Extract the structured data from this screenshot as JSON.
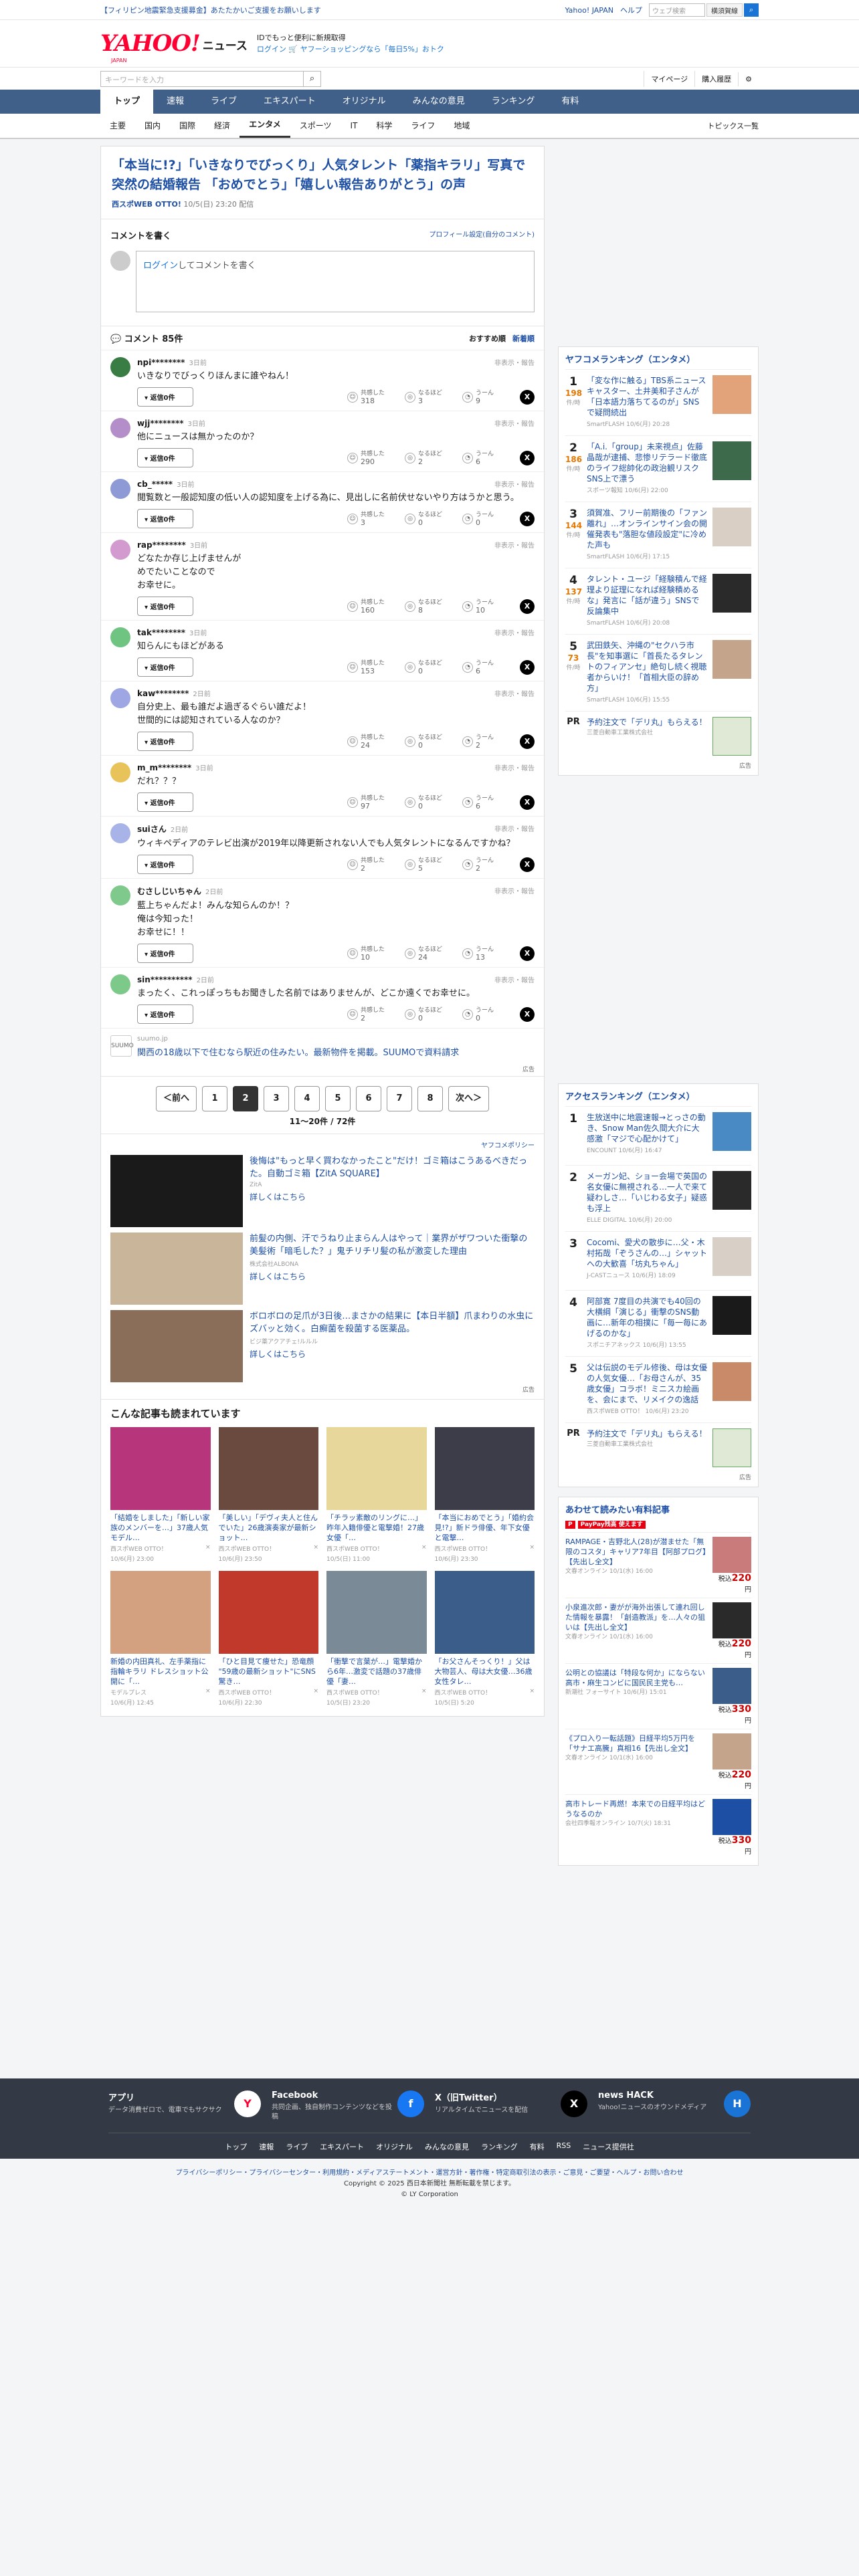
{
  "topbar": {
    "notice": "【フィリピン地震緊急支援募金】あたたかいご支援をお願いします",
    "links": [
      "Yahoo! JAPAN",
      "ヘルプ"
    ],
    "search_placeholder": "ウェブ検索",
    "search_btn": "横須賀線"
  },
  "header": {
    "logo": "YAHOO!",
    "news": "ニュース",
    "logo_sub": "JAPAN",
    "info1": "IDでもっと便利に新規取得",
    "info2": "ログイン 🛒 ヤフーショッピングなら「毎日5%」おトク"
  },
  "searchrow": {
    "placeholder": "キーワードを入力",
    "mypage": "マイページ",
    "purchase": "購入履歴"
  },
  "gnav": [
    "トップ",
    "速報",
    "ライブ",
    "エキスパート",
    "オリジナル",
    "みんなの意見",
    "ランキング",
    "有料"
  ],
  "snav": {
    "items": [
      "主要",
      "国内",
      "国際",
      "経済",
      "エンタメ",
      "スポーツ",
      "IT",
      "科学",
      "ライフ",
      "地域"
    ],
    "topics": "トピックス一覧"
  },
  "article": {
    "title": "「本当に!?」「いきなりでびっくり」人気タレント「薬指キラリ」写真で突然の結婚報告 「おめでとう」「嬉しい報告ありがとう」の声",
    "source": "西スポWEB OTTO!",
    "date": "10/5(日) 23:20 配信"
  },
  "comment_write": {
    "title": "コメントを書く",
    "profile": "プロフィール設定(自分のコメント)",
    "login": "ログイン",
    "placeholder": "してコメントを書く"
  },
  "comment_list": {
    "title": "コメント 85件",
    "sort1": "おすすめ順",
    "sort2": "新着順"
  },
  "reply_label": "返信0件",
  "report_label": "非表示・報告",
  "react_labels": [
    "共感した",
    "なるほど",
    "うーん"
  ],
  "comments": [
    {
      "name": "npi********",
      "time": "3日前",
      "text": "いきなりでびっくりほんまに誰やねん！",
      "r": [
        "318",
        "3",
        "9"
      ],
      "color": "#3a7d44"
    },
    {
      "name": "wjj********",
      "time": "3日前",
      "text": "他にニュースは無かったのか？",
      "r": [
        "290",
        "2",
        "6"
      ],
      "color": "#b48ec9"
    },
    {
      "name": "cb_*****",
      "time": "3日前",
      "text": "閲覧数と一般認知度の低い人の認知度を上げる為に、見出しに名前伏せないやり方はうかと思う。",
      "r": [
        "3",
        "0",
        "0"
      ],
      "color": "#8e9ad6"
    },
    {
      "name": "rap********",
      "time": "3日前",
      "text": "どなたか存じ上げませんが\nめでたいことなので\nお幸せに。",
      "r": [
        "160",
        "8",
        "10"
      ],
      "color": "#d39ad0"
    },
    {
      "name": "tak********",
      "time": "3日前",
      "text": "知らんにもほどがある",
      "r": [
        "153",
        "0",
        "6"
      ],
      "color": "#6fc481"
    },
    {
      "name": "kaw********",
      "time": "2日前",
      "text": "自分史上、最も誰だよ過ぎるぐらい誰だよ！\n世間的には認知されている人なのか？",
      "r": [
        "24",
        "0",
        "2"
      ],
      "color": "#9fa6e4"
    },
    {
      "name": "m_m********",
      "time": "3日前",
      "text": "だれ？？？",
      "r": [
        "97",
        "0",
        "6"
      ],
      "color": "#e8c35a"
    },
    {
      "name": "suiさん",
      "time": "2日前",
      "text": "ウィキペディアのテレビ出演が2019年以降更新されない人でも人気タレントになるんですかね？",
      "r": [
        "2",
        "5",
        "2"
      ],
      "color": "#a8b3e8"
    },
    {
      "name": "むさしじいちゃん",
      "time": "2日前",
      "text": "藍上ちゃんだよ！みんな知らんのか！？\n俺は今知った！\nお幸せに！！",
      "r": [
        "10",
        "24",
        "13"
      ],
      "color": "#7ec98b"
    },
    {
      "name": "sin**********",
      "time": "2日前",
      "text": "まったく、これっぽっちもお聞きした名前ではありませんが、どこか遠くでお幸せに。",
      "r": [
        "2",
        "0",
        "0"
      ],
      "color": "#7dc98a"
    }
  ],
  "ad1": {
    "logo": "SUUMO",
    "src": "suumo.jp",
    "title": "関西の18歳以下で住むなら駅近の住みたい。最新物件を掲載。SUUMOで資料請求",
    "label": "広告"
  },
  "pager": {
    "prev": "＜前へ",
    "pages": [
      "1",
      "2",
      "3",
      "4",
      "5",
      "6",
      "7",
      "8"
    ],
    "current": "2",
    "next": "次へ＞",
    "info": "11〜20件 / 72件"
  },
  "ads2": {
    "policy": "ヤフコメポリシー",
    "items": [
      {
        "title": "後悔は\"もっと早く買わなかったこと\"だけ！ゴミ箱はこうあるべきだった。自動ゴミ箱【ZitA SQUARE】",
        "src": "ZitA",
        "more": "詳しくはこちら",
        "bg": "#1a1a1a"
      },
      {
        "title": "前髪の内側、汗でうねり止まらん人はやって｜業界がザワついた衝撃の美髪術「暗毛した？」鬼チリチリ髪の私が激変した理由",
        "src": "株式会社ALBONA",
        "more": "詳しくはこちら",
        "bg": "#c9b59a"
      },
      {
        "title": "ボロボロの足爪が3日後…まさかの結果に【本日半額】爪まわりの水虫にズバッと効く。白癬菌を殺菌する医薬品。",
        "src": "ビジ薬アクアチェ!ルルル",
        "more": "詳しくはこちら",
        "bg": "#8b6e5a"
      }
    ],
    "label": "広告"
  },
  "related": {
    "title": "こんな記事も読まれています",
    "items": [
      {
        "t": "「結婚をしました」「新しい家族のメンバーを…」37歳人気モデル…",
        "s": "西スポWEB OTTO！",
        "d": "10/6(月) 23:00",
        "bg": "#b7357a"
      },
      {
        "t": "「美しい」「デヴィ夫人と住んでいた」26歳演奏家が最新ショット…",
        "s": "西スポWEB OTTO！",
        "d": "10/6(月) 23:50",
        "bg": "#6a4a3e"
      },
      {
        "t": "「チラッ素敵のリングに…」昨年入籍俳優と電撃婚！27歳女優「…",
        "s": "西スポWEB OTTO！",
        "d": "10/5(日) 11:00",
        "bg": "#e8d79a"
      },
      {
        "t": "「本当におめでとう」「婚約会見!?」新ドラ俳優、年下女優と電撃…",
        "s": "西スポWEB OTTO！",
        "d": "10/6(月) 23:30",
        "bg": "#3d3d4a"
      },
      {
        "t": "新婚の内田真礼、左手薬指に指輪キラリ ドレスショット公開に「…",
        "s": "モデルプレス",
        "d": "10/6(月) 12:45",
        "bg": "#d3a17f"
      },
      {
        "t": "「ひと目見て痩せた」恐竜顔 \"59歳の最新ショット\"にSNS驚き…",
        "s": "西スポWEB OTTO！",
        "d": "10/6(月) 22:30",
        "bg": "#c0392b"
      },
      {
        "t": "「衝撃で言葉が…」電撃婚から6年…激変で話題の37歳俳優「妻…",
        "s": "西スポWEB OTTO！",
        "d": "10/5(日) 23:20",
        "bg": "#7a8a96"
      },
      {
        "t": "「お父さんそっくり！」父は大物芸人、母は大女優…36歳女性タレ…",
        "s": "西スポWEB OTTO！",
        "d": "10/5(日) 5:20",
        "bg": "#3a5d8a"
      }
    ]
  },
  "yahoo_rank": {
    "title": "ヤフコメランキング（エンタメ）",
    "items": [
      {
        "n": "1",
        "c": "198",
        "u": "件/時",
        "t": "「変な作に触る」TBS系ニュースキャスター、土井美和子さんが「日本語力落ちてるのが」SNSで疑問続出",
        "s": "SmartFLASH 10/6(月) 20:28",
        "bg": "#e2a27a"
      },
      {
        "n": "2",
        "c": "186",
        "u": "件/時",
        "t": "「A.i.「group」未来視点」佐藤晶哉が逮捕、悲惨リテラード徹底のライフ総帥化の政治観リスクSNS上で漂う",
        "s": "スポーツ報知 10/6(月) 22:00",
        "bg": "#3d6a4a"
      },
      {
        "n": "3",
        "c": "144",
        "u": "件/時",
        "t": "須賀准、フリー前期後の「ファン離れ」…オンラインサイン会の開催発表も\"落胆な値段設定\"に冷めた声も",
        "s": "SmartFLASH 10/6(月) 17:15",
        "bg": "#d9cfc4"
      },
      {
        "n": "4",
        "c": "137",
        "u": "件/時",
        "t": "タレント・ユージ「経験積んで経理より証理になれば経験積めるな」発言に「話が違う」SNSで反論集中",
        "s": "SmartFLASH 10/6(月) 20:08",
        "bg": "#2a2a2a"
      },
      {
        "n": "5",
        "c": "73",
        "u": "件/時",
        "t": "武田鉄矢、沖縄の\"セクハラ市長\"を知事選に「首長たるタレントのフィアンセ」絶句し続く視聴者からいけ！「首相大臣の辞め方」",
        "s": "SmartFLASH 10/6(月) 15:55",
        "bg": "#c4a48a"
      }
    ],
    "pr": {
      "t": "予約注文で「デリ丸」もらえる！",
      "s": "三菱自動車工業株式会社"
    },
    "label": "広告"
  },
  "access_rank": {
    "title": "アクセスランキング（エンタメ）",
    "items": [
      {
        "n": "1",
        "t": "生放送中に地震速報→とっさの動き、Snow Man佐久間大介に大感激「マジで心配かけて」",
        "s": "ENCOUNT 10/6(月) 16:47",
        "bg": "#4a8ac4"
      },
      {
        "n": "2",
        "t": "メーガン妃、ショー会場で英国の名女優に無視される…一人で来て疑わしさ…「いじわる女子」疑惑も浮上",
        "s": "ELLE DIGITAL 10/6(月) 20:00",
        "bg": "#2a2a2a"
      },
      {
        "n": "3",
        "t": "Cocomi、愛犬の散歩に…父・木村拓哉「ぞうさんの…」シャットへの大歓喜「坊丸ちゃん」",
        "s": "J-CASTニュース 10/6(月) 18:09",
        "bg": "#d8d0c6"
      },
      {
        "n": "4",
        "t": "阿部寛 7度目の共演でも40回の大横綱「演じる」衝撃のSNS動画に…新年の相撲に「毎一毎にあげるのかな」",
        "s": "スポニチアネックス 10/6(月) 13:55",
        "bg": "#1a1a1a"
      },
      {
        "n": "5",
        "t": "父は伝説のモデル修後、母は女優の人気女優…「お母さんが、35歳女優」コラボ！ミニスカ絵画を、会にまで、リメイクの逸話",
        "s": "西スポWEB OTTO！ 10/6(月) 23:20",
        "bg": "#c98a6a"
      }
    ],
    "pr": {
      "t": "予約注文で「デリ丸」もらえる！",
      "s": "三菱自動車工業株式会社"
    },
    "label": "広告"
  },
  "paid": {
    "title": "あわせて読みたい有料記事",
    "pp": "PayPay残高 使えます",
    "items": [
      {
        "t": "RAMPAGE・吉野北人(28)が潜ませた「無限のコスタ」キャリア7年目【阿部プログ】【先出し全文】",
        "s": "文春オンライン 10/1(水) 16:00",
        "p": "220",
        "bg": "#c97a7a"
      },
      {
        "t": "小泉進次郎・妻がが海外出張して連れ回した情報を暴露！「創造教派」を…人々の狙いは【先出し全文】",
        "s": "文春オンライン 10/1(水) 16:00",
        "p": "220",
        "bg": "#2a2a2a"
      },
      {
        "t": "公明との協議は「特段な何か」にならない 高市・麻生コンビに国民民主党も…",
        "s": "新潮社 フォーサイト 10/6(月) 15:01",
        "p": "330",
        "bg": "#3a5d8a"
      },
      {
        "t": "《プロ入り一転話題》日経平均5万円を「サナエ高騰」真相16【先出し全文】",
        "s": "文春オンライン 10/1(水) 16:00",
        "p": "220",
        "bg": "#c4a48a"
      },
      {
        "t": "高市トレード再燃！本来での日経平均はどうなるのか",
        "s": "会社四季報オンライン 10/7(火) 18:31",
        "p": "330",
        "bg": "#1d4fa4"
      }
    ]
  },
  "footer": {
    "items": [
      {
        "t": "アプリ",
        "s": "データ消費ゼロで、電車でもサクサク",
        "ic": "Y",
        "bg": "#fff",
        "fg": "#ff0033"
      },
      {
        "t": "Facebook",
        "s": "共同企画、独自制作コンテンツなどを投稿",
        "ic": "f",
        "bg": "#1877f2",
        "fg": "#fff"
      },
      {
        "t": "X（旧Twitter）",
        "s": "リアルタイムでニュースを配信",
        "ic": "X",
        "bg": "#000",
        "fg": "#fff"
      },
      {
        "t": "news HACK",
        "s": "Yahoo!ニュースのオウンドメディア",
        "ic": "H",
        "bg": "#1a74d5",
        "fg": "#fff"
      }
    ],
    "links": [
      "トップ",
      "速報",
      "ライブ",
      "エキスパート",
      "オリジナル",
      "みんなの意見",
      "ランキング",
      "有料",
      "RSS",
      "ニュース提供社"
    ]
  },
  "bottom": {
    "l1": "プライバシーポリシー・プライバシーセンター・利用規約・メディアステートメント・運営方針・著作権・特定商取引法の表示・ご意見・ご要望・ヘルプ・お問い合わせ",
    "l2": "Copyright © 2025 西日本新聞社 無断転載を禁じます。",
    "l3": "© LY Corporation"
  }
}
